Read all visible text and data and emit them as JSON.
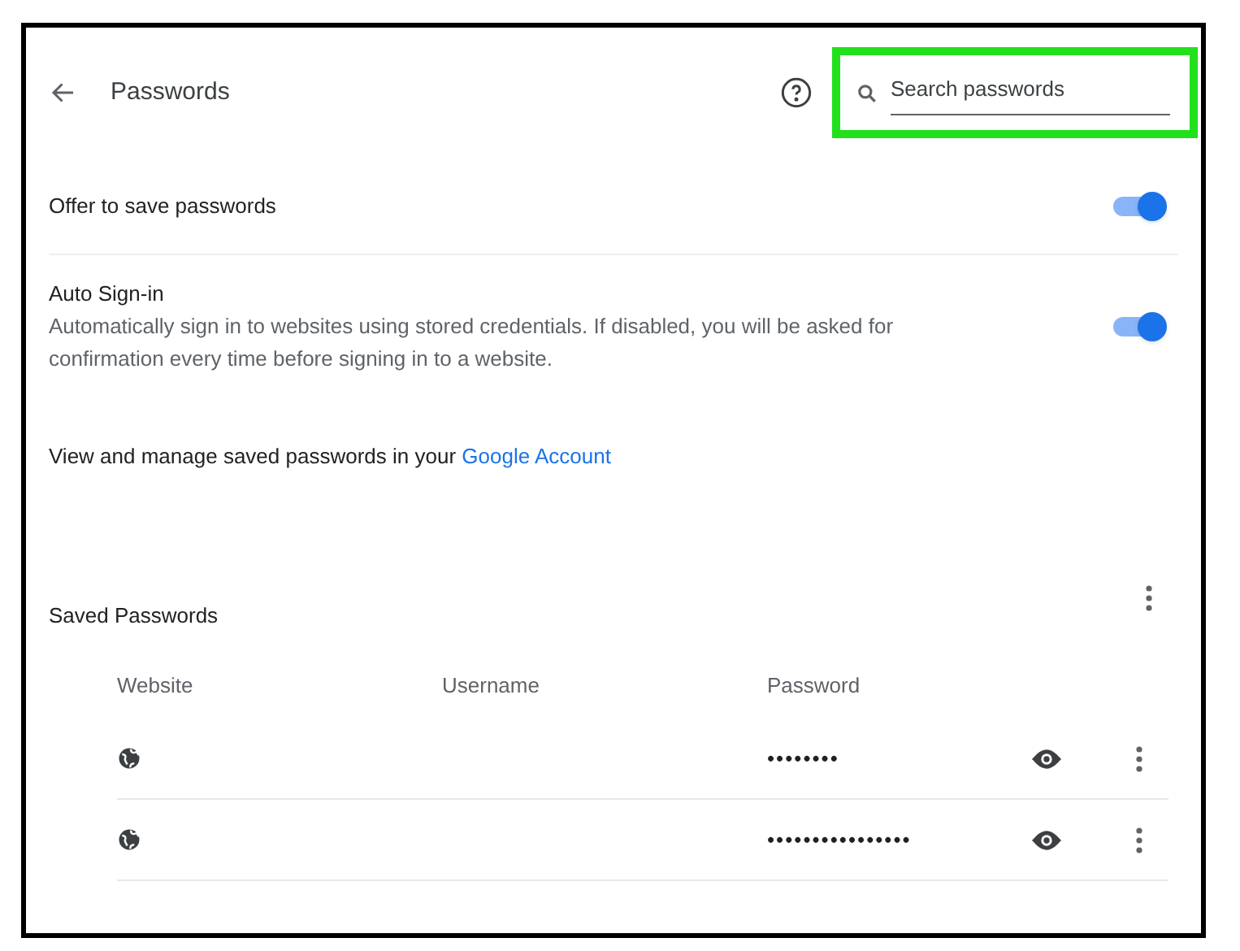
{
  "header": {
    "title": "Passwords",
    "search": {
      "placeholder": "Search passwords",
      "highlighted": true
    }
  },
  "settings": [
    {
      "label": "Offer to save passwords",
      "on": true
    },
    {
      "label": "Auto Sign-in",
      "description": "Automatically sign in to websites using stored credentials. If disabled, you will be asked for confirmation every time before signing in to a website.",
      "on": true
    }
  ],
  "account_note": {
    "text": "View and manage saved passwords in your ",
    "link": "Google Account"
  },
  "saved_passwords": {
    "title": "Saved Passwords",
    "columns": [
      "Website",
      "Username",
      "Password"
    ],
    "rows": [
      {
        "password": "••••••••"
      },
      {
        "password": "••••••••••••••••"
      }
    ]
  }
}
